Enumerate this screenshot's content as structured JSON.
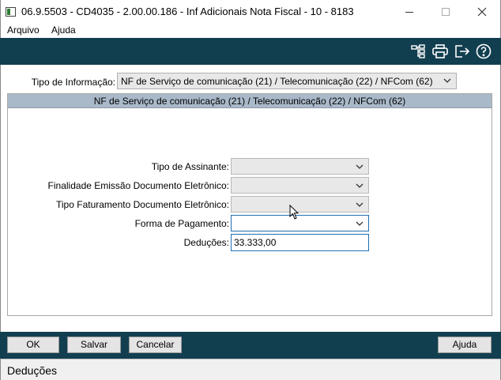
{
  "window": {
    "title": "06.9.5503 - CD4035 - 2.00.00.186 - Inf Adicionais Nota Fiscal - 10 - 8183"
  },
  "menu": {
    "items": [
      "Arquivo",
      "Ajuda"
    ]
  },
  "toolbar": {
    "icons": [
      "tree-structure-icon",
      "printer-icon",
      "exit-icon",
      "help-icon"
    ]
  },
  "form": {
    "tipo_informacao_label": "Tipo de Informação:",
    "tipo_informacao_value": "NF de Serviço de comunicação (21) / Telecomunicação (22) / NFCom (62)",
    "panel_title": "NF de Serviço de comunicação (21) / Telecomunicação (22) / NFCom (62)",
    "fields": [
      {
        "label": "Tipo de Assinante:",
        "value": ""
      },
      {
        "label": "Finalidade Emissão Documento Eletrônico:",
        "value": ""
      },
      {
        "label": "Tipo Faturamento Documento Eletrônico:",
        "value": ""
      },
      {
        "label": "Forma de Pagamento:",
        "value": ""
      },
      {
        "label": "Deduções:",
        "value": "33.333,00"
      }
    ]
  },
  "buttons": {
    "ok": "OK",
    "salvar": "Salvar",
    "cancelar": "Cancelar",
    "ajuda": "Ajuda"
  },
  "status": {
    "text": "Deduções"
  },
  "colors": {
    "toolbar_bg": "#123f50",
    "panel_header_bg": "#a9b9c9",
    "focus_border": "#1f6fb0"
  }
}
